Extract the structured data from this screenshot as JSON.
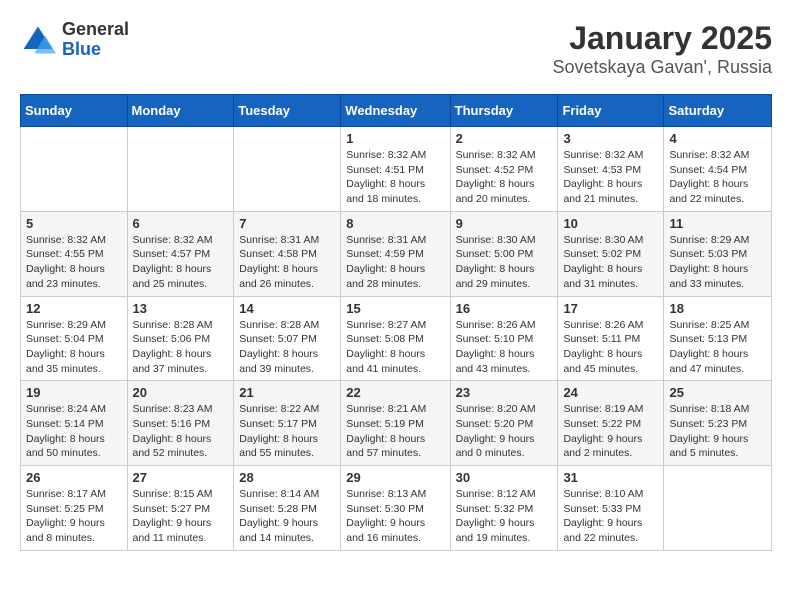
{
  "logo": {
    "general": "General",
    "blue": "Blue"
  },
  "header": {
    "title": "January 2025",
    "location": "Sovetskaya Gavan', Russia"
  },
  "weekdays": [
    "Sunday",
    "Monday",
    "Tuesday",
    "Wednesday",
    "Thursday",
    "Friday",
    "Saturday"
  ],
  "weeks": [
    [
      {
        "day": "",
        "info": ""
      },
      {
        "day": "",
        "info": ""
      },
      {
        "day": "",
        "info": ""
      },
      {
        "day": "1",
        "info": "Sunrise: 8:32 AM\nSunset: 4:51 PM\nDaylight: 8 hours\nand 18 minutes."
      },
      {
        "day": "2",
        "info": "Sunrise: 8:32 AM\nSunset: 4:52 PM\nDaylight: 8 hours\nand 20 minutes."
      },
      {
        "day": "3",
        "info": "Sunrise: 8:32 AM\nSunset: 4:53 PM\nDaylight: 8 hours\nand 21 minutes."
      },
      {
        "day": "4",
        "info": "Sunrise: 8:32 AM\nSunset: 4:54 PM\nDaylight: 8 hours\nand 22 minutes."
      }
    ],
    [
      {
        "day": "5",
        "info": "Sunrise: 8:32 AM\nSunset: 4:55 PM\nDaylight: 8 hours\nand 23 minutes."
      },
      {
        "day": "6",
        "info": "Sunrise: 8:32 AM\nSunset: 4:57 PM\nDaylight: 8 hours\nand 25 minutes."
      },
      {
        "day": "7",
        "info": "Sunrise: 8:31 AM\nSunset: 4:58 PM\nDaylight: 8 hours\nand 26 minutes."
      },
      {
        "day": "8",
        "info": "Sunrise: 8:31 AM\nSunset: 4:59 PM\nDaylight: 8 hours\nand 28 minutes."
      },
      {
        "day": "9",
        "info": "Sunrise: 8:30 AM\nSunset: 5:00 PM\nDaylight: 8 hours\nand 29 minutes."
      },
      {
        "day": "10",
        "info": "Sunrise: 8:30 AM\nSunset: 5:02 PM\nDaylight: 8 hours\nand 31 minutes."
      },
      {
        "day": "11",
        "info": "Sunrise: 8:29 AM\nSunset: 5:03 PM\nDaylight: 8 hours\nand 33 minutes."
      }
    ],
    [
      {
        "day": "12",
        "info": "Sunrise: 8:29 AM\nSunset: 5:04 PM\nDaylight: 8 hours\nand 35 minutes."
      },
      {
        "day": "13",
        "info": "Sunrise: 8:28 AM\nSunset: 5:06 PM\nDaylight: 8 hours\nand 37 minutes."
      },
      {
        "day": "14",
        "info": "Sunrise: 8:28 AM\nSunset: 5:07 PM\nDaylight: 8 hours\nand 39 minutes."
      },
      {
        "day": "15",
        "info": "Sunrise: 8:27 AM\nSunset: 5:08 PM\nDaylight: 8 hours\nand 41 minutes."
      },
      {
        "day": "16",
        "info": "Sunrise: 8:26 AM\nSunset: 5:10 PM\nDaylight: 8 hours\nand 43 minutes."
      },
      {
        "day": "17",
        "info": "Sunrise: 8:26 AM\nSunset: 5:11 PM\nDaylight: 8 hours\nand 45 minutes."
      },
      {
        "day": "18",
        "info": "Sunrise: 8:25 AM\nSunset: 5:13 PM\nDaylight: 8 hours\nand 47 minutes."
      }
    ],
    [
      {
        "day": "19",
        "info": "Sunrise: 8:24 AM\nSunset: 5:14 PM\nDaylight: 8 hours\nand 50 minutes."
      },
      {
        "day": "20",
        "info": "Sunrise: 8:23 AM\nSunset: 5:16 PM\nDaylight: 8 hours\nand 52 minutes."
      },
      {
        "day": "21",
        "info": "Sunrise: 8:22 AM\nSunset: 5:17 PM\nDaylight: 8 hours\nand 55 minutes."
      },
      {
        "day": "22",
        "info": "Sunrise: 8:21 AM\nSunset: 5:19 PM\nDaylight: 8 hours\nand 57 minutes."
      },
      {
        "day": "23",
        "info": "Sunrise: 8:20 AM\nSunset: 5:20 PM\nDaylight: 9 hours\nand 0 minutes."
      },
      {
        "day": "24",
        "info": "Sunrise: 8:19 AM\nSunset: 5:22 PM\nDaylight: 9 hours\nand 2 minutes."
      },
      {
        "day": "25",
        "info": "Sunrise: 8:18 AM\nSunset: 5:23 PM\nDaylight: 9 hours\nand 5 minutes."
      }
    ],
    [
      {
        "day": "26",
        "info": "Sunrise: 8:17 AM\nSunset: 5:25 PM\nDaylight: 9 hours\nand 8 minutes."
      },
      {
        "day": "27",
        "info": "Sunrise: 8:15 AM\nSunset: 5:27 PM\nDaylight: 9 hours\nand 11 minutes."
      },
      {
        "day": "28",
        "info": "Sunrise: 8:14 AM\nSunset: 5:28 PM\nDaylight: 9 hours\nand 14 minutes."
      },
      {
        "day": "29",
        "info": "Sunrise: 8:13 AM\nSunset: 5:30 PM\nDaylight: 9 hours\nand 16 minutes."
      },
      {
        "day": "30",
        "info": "Sunrise: 8:12 AM\nSunset: 5:32 PM\nDaylight: 9 hours\nand 19 minutes."
      },
      {
        "day": "31",
        "info": "Sunrise: 8:10 AM\nSunset: 5:33 PM\nDaylight: 9 hours\nand 22 minutes."
      },
      {
        "day": "",
        "info": ""
      }
    ]
  ]
}
